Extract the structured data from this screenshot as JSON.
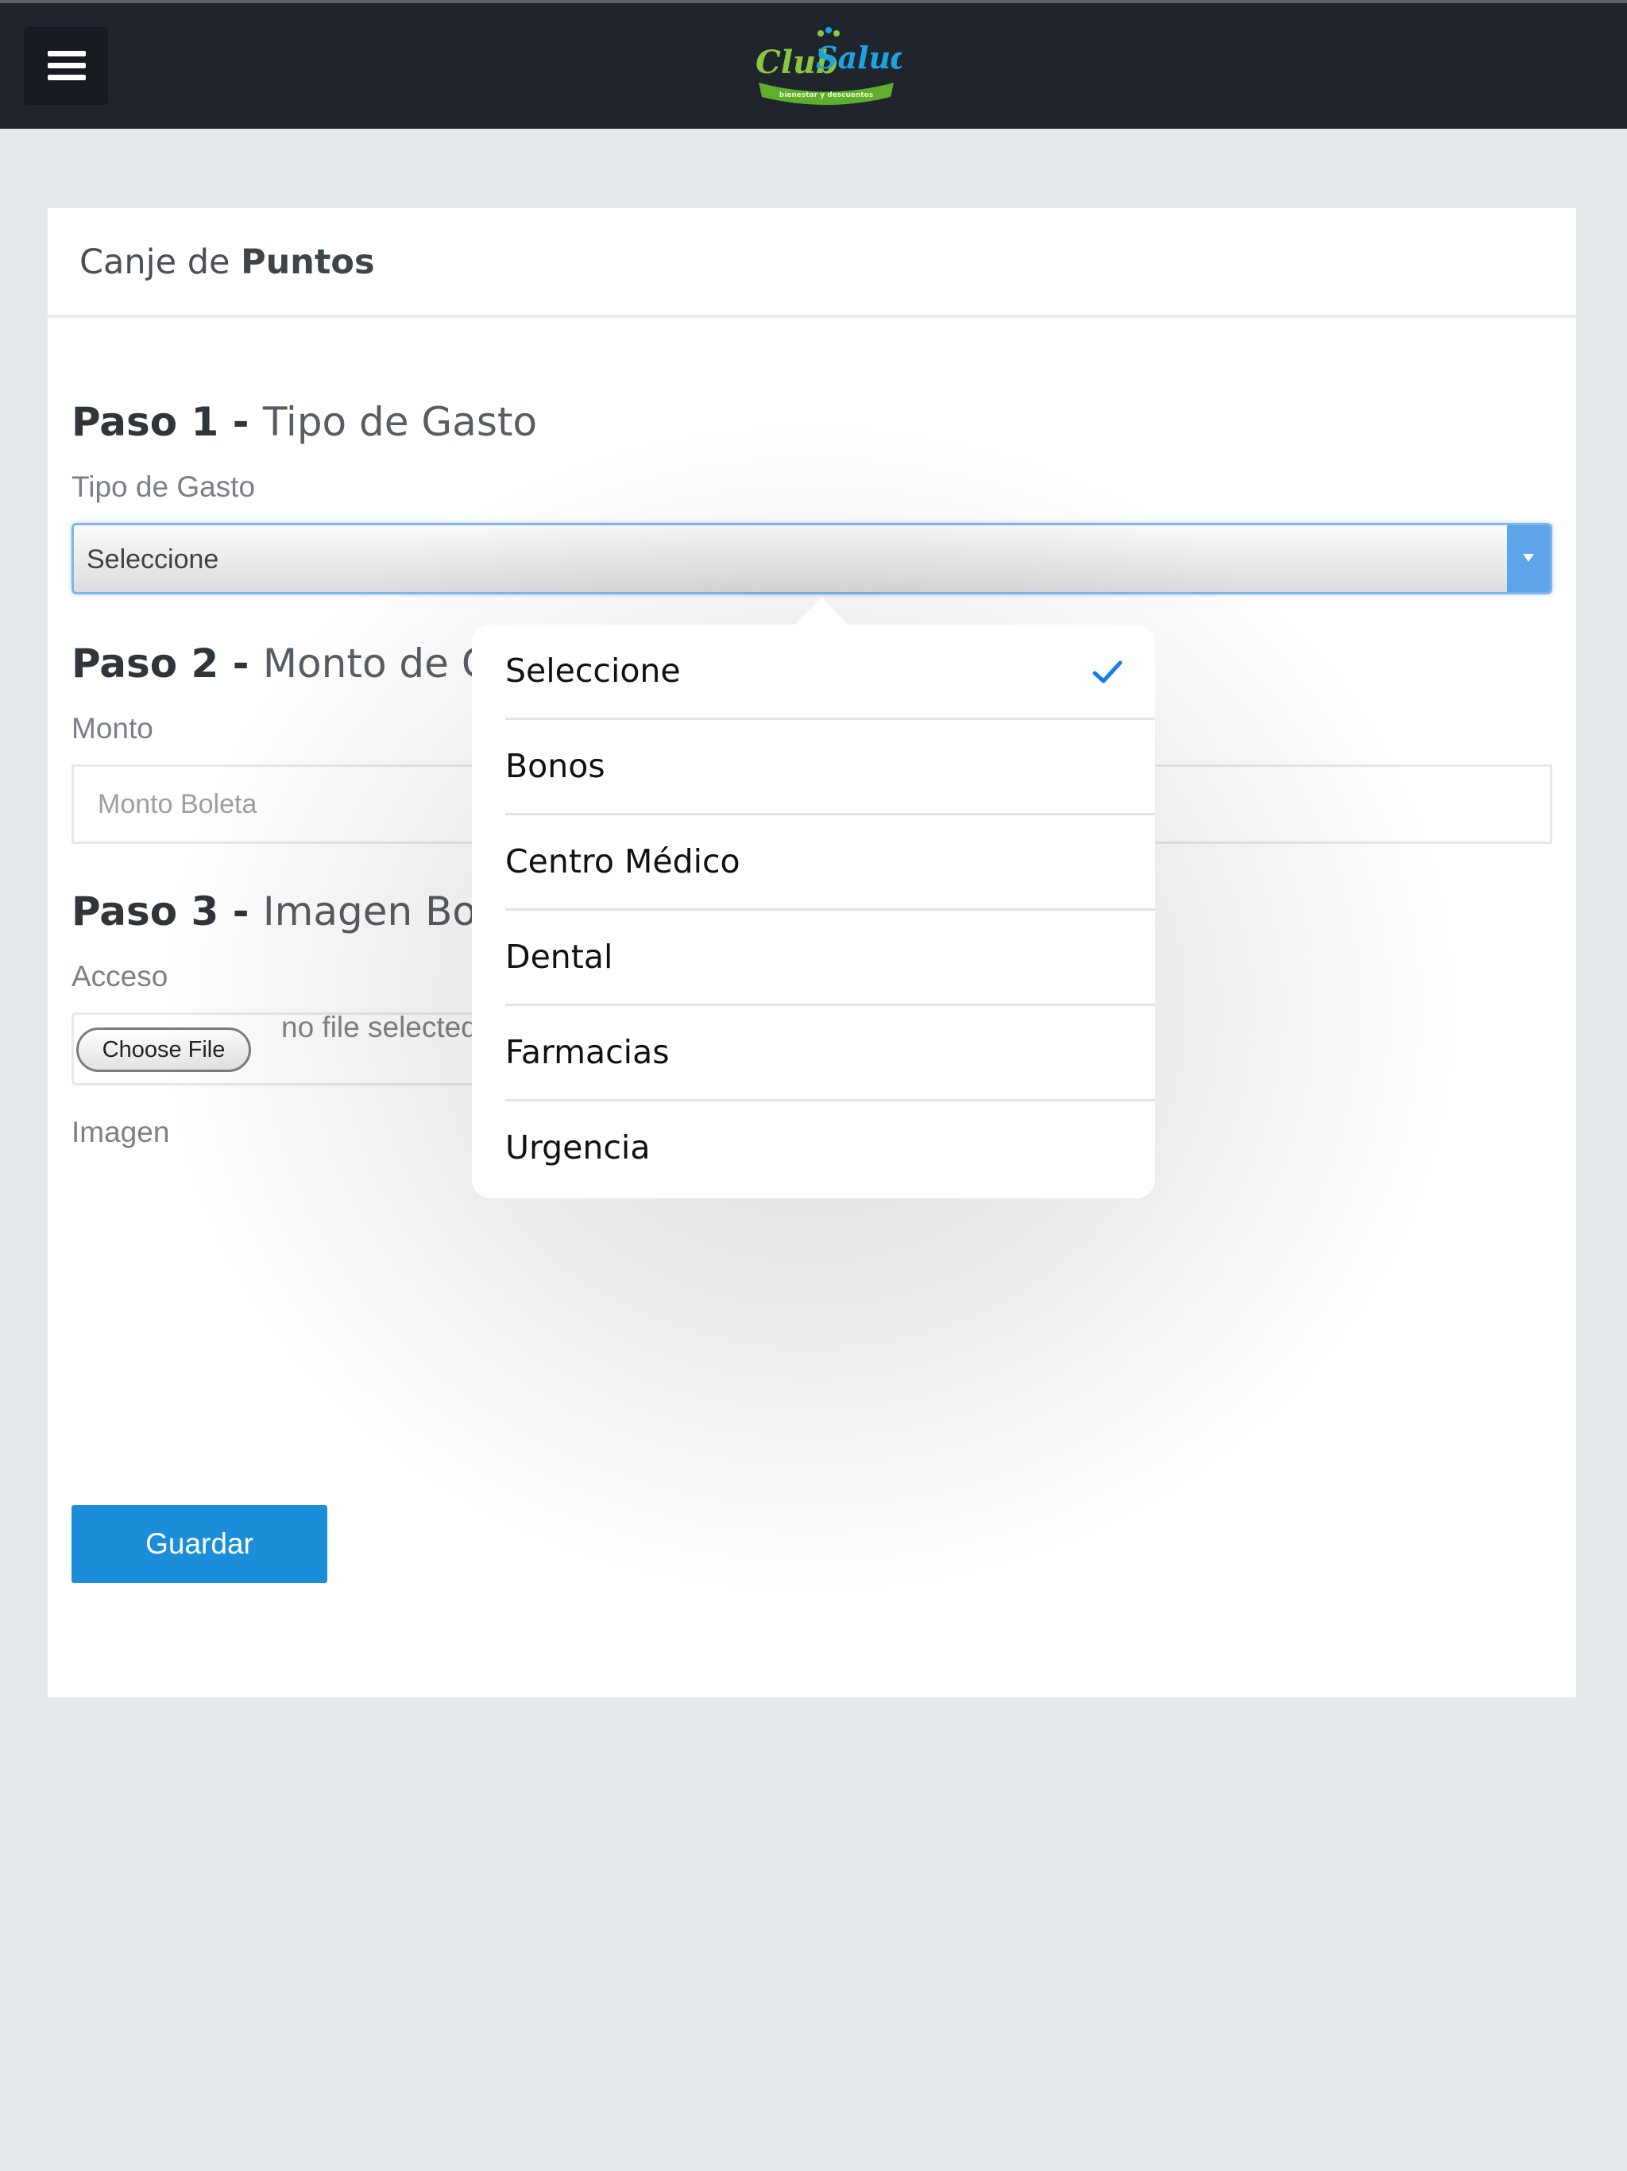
{
  "header": {
    "logo_text": "ClubSalud",
    "logo_tagline": "bienestar y descuentos"
  },
  "card": {
    "title_prefix": "Canje de ",
    "title_strong": "Puntos"
  },
  "step1": {
    "number": "Paso 1 - ",
    "title": "Tipo de Gasto",
    "label": "Tipo de Gasto",
    "selected_value": "Seleccione"
  },
  "step2": {
    "number": "Paso 2 - ",
    "title": "Monto de Gasto",
    "label": "Monto",
    "placeholder": "Monto Boleta"
  },
  "step3": {
    "number": "Paso 3 - ",
    "title": "Imagen Boleta",
    "label": "Acceso",
    "file_button": "Choose File",
    "file_status": "no file selected",
    "image_label": "Imagen"
  },
  "actions": {
    "save_label": "Guardar"
  },
  "dropdown": {
    "options": [
      {
        "label": "Seleccione",
        "selected": true
      },
      {
        "label": "Bonos",
        "selected": false
      },
      {
        "label": "Centro Médico",
        "selected": false
      },
      {
        "label": "Dental",
        "selected": false
      },
      {
        "label": "Farmacias",
        "selected": false
      },
      {
        "label": "Urgencia",
        "selected": false
      }
    ]
  },
  "colors": {
    "nav_background": "#20252d",
    "accent_blue": "#1c8ed9",
    "checkmark_blue": "#1a7cf5",
    "logo_green": "#8cc63f",
    "logo_blue": "#1fa3e0"
  },
  "icons": {
    "menu": "hamburger-menu-icon",
    "check": "checkmark-icon",
    "select_arrow": "triangle-down-icon"
  }
}
